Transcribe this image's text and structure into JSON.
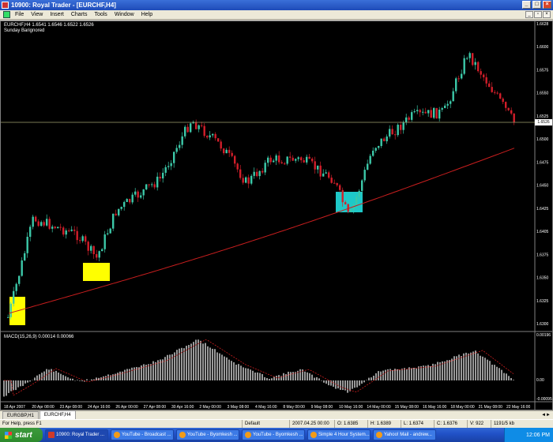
{
  "window": {
    "title": "10900: Royal Trader - [EURCHF,H4]"
  },
  "menu": [
    "File",
    "View",
    "Insert",
    "Charts",
    "Tools",
    "Window",
    "Help"
  ],
  "chart": {
    "symbol_line": "EURCHF,H4  1.6541 1.6546 1.6522 1.6526",
    "indicator_line": "Sunday Barignored",
    "macd_label": "MACD(15,26,9) 0.00014 0.00066",
    "current_price": "1.6526",
    "price_ticks": [
      "1.6628",
      "1.6600",
      "1.6575",
      "1.6550",
      "1.6525",
      "1.6500",
      "1.6475",
      "1.6450",
      "1.6425",
      "1.6405",
      "1.6375",
      "1.6350",
      "1.6325",
      "1.6300"
    ],
    "macd_ticks": [
      "0.00196",
      "0.00",
      "-0.00095"
    ],
    "time_ticks": [
      "18 Apr 2007",
      "20 Apr 08:00",
      "23 Apr 08:00",
      "24 Apr 16:00",
      "26 Apr 00:00",
      "27 Apr 08:00",
      "30 Apr 16:00",
      "2 May 00:00",
      "3 May 08:00",
      "4 May 16:00",
      "8 May 00:00",
      "9 May 08:00",
      "10 May 16:00",
      "14 May 00:00",
      "15 May 08:00",
      "16 May 16:00",
      "18 May 00:00",
      "21 May 08:00",
      "22 May 16:00"
    ],
    "colors": {
      "bull": "#3cc8a8",
      "bear": "#d21e2a",
      "ma": "#c81e1e",
      "hline": "#a0a070",
      "highlight_yellow": "#ffff00",
      "highlight_cyan": "#1ec8c8"
    }
  },
  "tabs": [
    "EURGBP,H1",
    "EURCHF,H4"
  ],
  "status": {
    "help": "For Help, press F1",
    "profile": "Default",
    "time": "2007.04.25 00:00",
    "open": "O: 1.6385",
    "high": "H: 1.6389",
    "low": "L: 1.6374",
    "close": "C: 1.6376",
    "volume": "V: 922",
    "traffic": "1191/5 kb"
  },
  "taskbar": {
    "start": "start",
    "buttons": [
      "10900: Royal Trader ...",
      "YouTube - Broadcast ...",
      "YouTube - Byomkesh ...",
      "YouTube - Byomkesh ...",
      "Simple 4 Hour System...",
      "Yahoo! Mail - andrew..."
    ],
    "clock": "12:06 PM"
  }
}
